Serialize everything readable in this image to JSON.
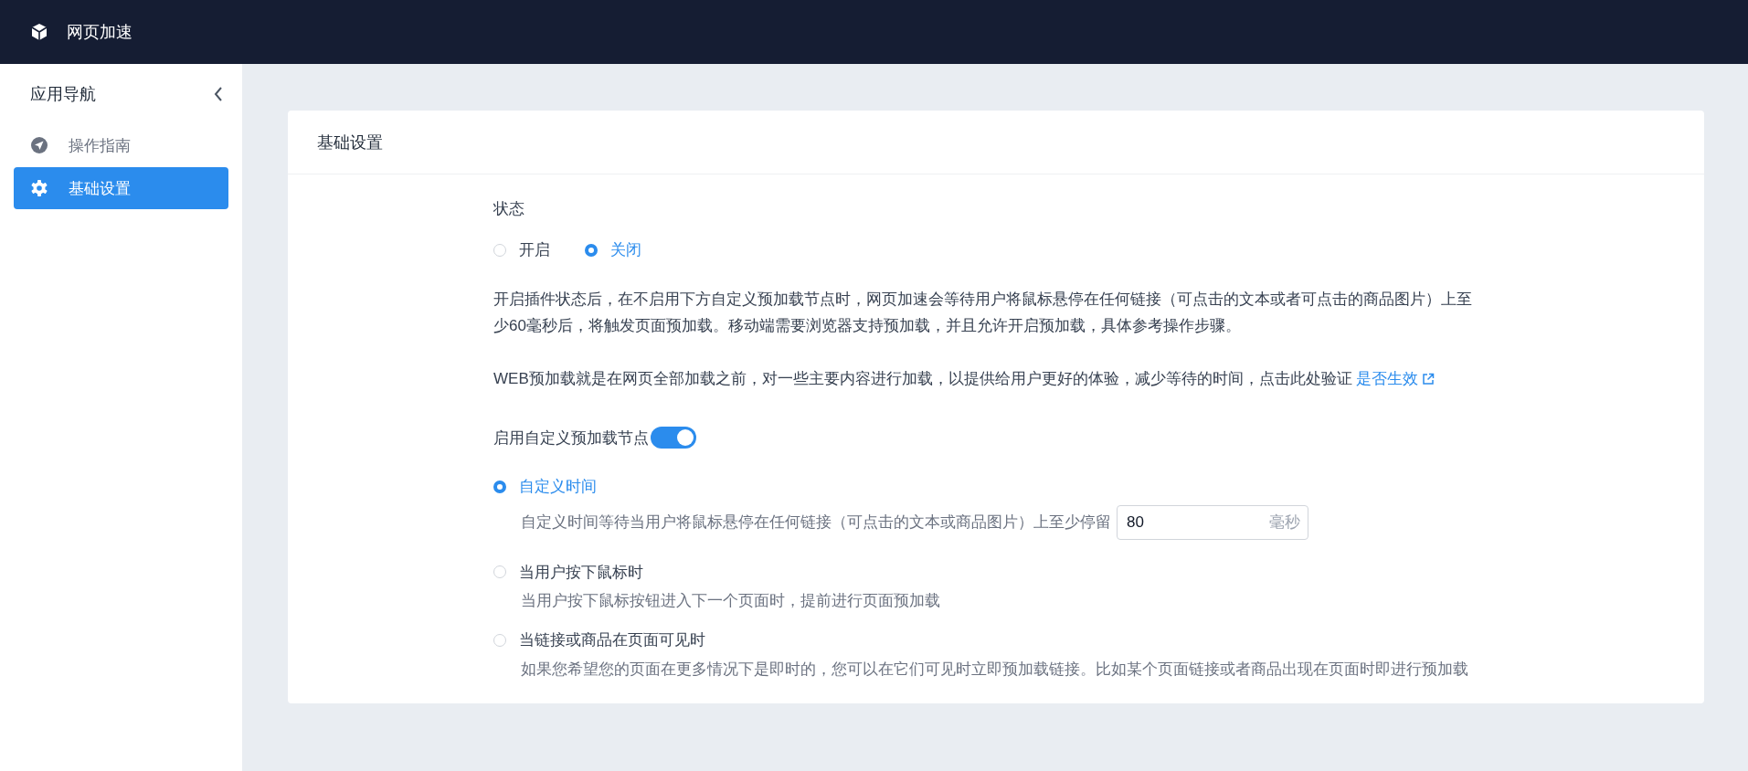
{
  "header": {
    "title": "网页加速"
  },
  "sidebar": {
    "title": "应用导航",
    "items": [
      {
        "label": "操作指南",
        "selected": false
      },
      {
        "label": "基础设置",
        "selected": true
      }
    ]
  },
  "card": {
    "title": "基础设置",
    "status": {
      "label": "状态",
      "options": [
        {
          "label": "开启",
          "selected": false
        },
        {
          "label": "关闭",
          "selected": true
        }
      ]
    },
    "description": "开启插件状态后，在不启用下方自定义预加载节点时，网页加速会等待用户将鼠标悬停在任何链接（可点击的文本或者可点击的商品图片）上至少60毫秒后，将触发页面预加载。移动端需要浏览器支持预加载，并且允许开启预加载，具体参考操作步骤。",
    "web_note": {
      "text": "WEB预加载就是在网页全部加载之前，对一些主要内容进行加载，以提供给用户更好的体验，减少等待的时间，点击此处验证",
      "link": "是否生效"
    },
    "custom_toggle": {
      "label": "启用自定义预加载节点",
      "on": true
    },
    "modes": [
      {
        "label": "自定义时间",
        "selected": true,
        "description": "自定义时间等待当用户将鼠标悬停在任何链接（可点击的文本或商品图片）上至少停留",
        "input": {
          "value": "80",
          "suffix": "毫秒"
        }
      },
      {
        "label": "当用户按下鼠标时",
        "selected": false,
        "description": "当用户按下鼠标按钮进入下一个页面时，提前进行页面预加载"
      },
      {
        "label": "当链接或商品在页面可见时",
        "selected": false,
        "description": "如果您希望您的页面在更多情况下是即时的，您可以在它们可见时立即预加载链接。比如某个页面链接或者商品出现在页面时即进行预加载"
      }
    ]
  }
}
